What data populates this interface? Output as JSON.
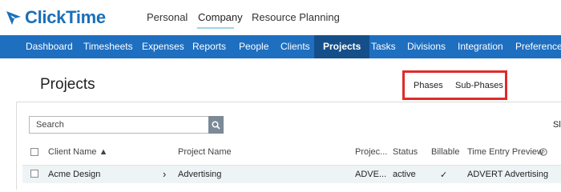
{
  "app": {
    "logo_text": "ClickTime"
  },
  "top_tabs": [
    {
      "label": "Personal"
    },
    {
      "label": "Company",
      "active": true
    },
    {
      "label": "Resource Planning"
    }
  ],
  "nav": [
    {
      "label": "Dashboard"
    },
    {
      "label": "Timesheets"
    },
    {
      "label": "Expenses"
    },
    {
      "label": "Reports"
    },
    {
      "label": "People"
    },
    {
      "label": "Clients"
    },
    {
      "label": "Projects",
      "active": true
    },
    {
      "label": "Tasks"
    },
    {
      "label": "Divisions"
    },
    {
      "label": "Integration"
    },
    {
      "label": "Preferences"
    }
  ],
  "page": {
    "title": "Projects",
    "links": {
      "phases": "Phases",
      "sub_phases": "Sub-Phases"
    },
    "search_placeholder": "Search",
    "cut_label": "Sl"
  },
  "table": {
    "columns": {
      "client": "Client Name ▲",
      "project": "Project Name",
      "project_code": "Projec...",
      "status": "Status",
      "billable": "Billable",
      "preview": "Time Entry Preview"
    },
    "rows": [
      {
        "client": "Acme Design",
        "expand": "›",
        "project": "Advertising",
        "project_code": "ADVE...",
        "status": "active",
        "billable": "✓",
        "preview": "ADVERT Advertising"
      }
    ]
  },
  "colors": {
    "brand": "#1b6fb9",
    "nav_bg": "#1e6fc0",
    "nav_active": "#154f8a",
    "highlight": "#e02a2a"
  }
}
